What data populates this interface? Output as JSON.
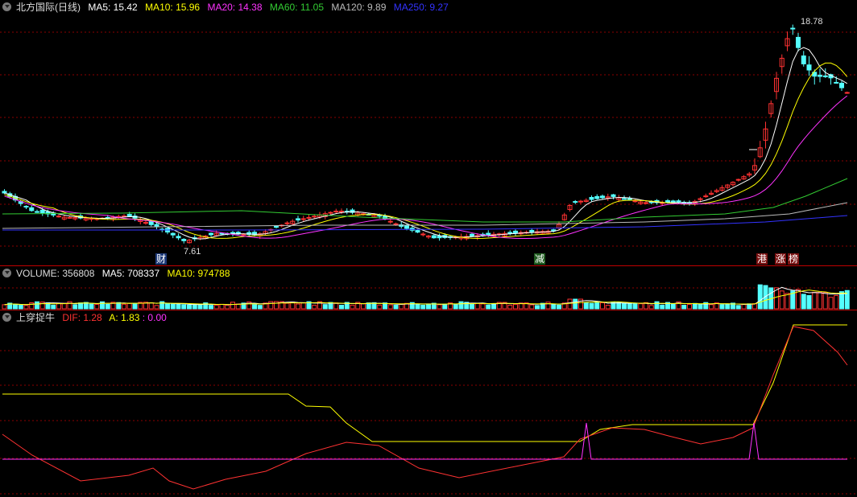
{
  "main": {
    "title": "北方国际(日线)",
    "ma": [
      {
        "label": "MA5: 15.42",
        "color": "#ffffff"
      },
      {
        "label": "MA10: 15.96",
        "color": "#ffff00"
      },
      {
        "label": "MA20: 14.38",
        "color": "#ff33ff"
      },
      {
        "label": "MA60: 11.05",
        "color": "#33cc33"
      },
      {
        "label": "MA120: 9.89",
        "color": "#bbbbbb"
      },
      {
        "label": "MA250: 9.27",
        "color": "#3333ff"
      }
    ],
    "high_label": "18.78",
    "low_label": "7.61",
    "events": [
      {
        "text": "财",
        "bg": "#1e3a78",
        "color": "#ffffff"
      },
      {
        "text": "减",
        "bg": "#1e5a1e",
        "color": "#ffffff"
      },
      {
        "text": "港",
        "bg": "#7a1010",
        "color": "#ffffff"
      },
      {
        "text": "涨",
        "bg": "#7a1010",
        "color": "#ffffff"
      },
      {
        "text": "榜",
        "bg": "#7a1010",
        "color": "#ffffff"
      }
    ]
  },
  "volume": {
    "title": "VOLUME: 356808",
    "ma5": "MA5: 708337",
    "ma10": "MA10: 974788"
  },
  "indicator": {
    "title": "上穿捉牛",
    "dif": "DIF: 1.28",
    "a": "A: 1.83",
    "z": ": 0.00"
  },
  "colors": {
    "up": "#ff3232",
    "down": "#54ffff",
    "grid": "#8b0000"
  }
}
